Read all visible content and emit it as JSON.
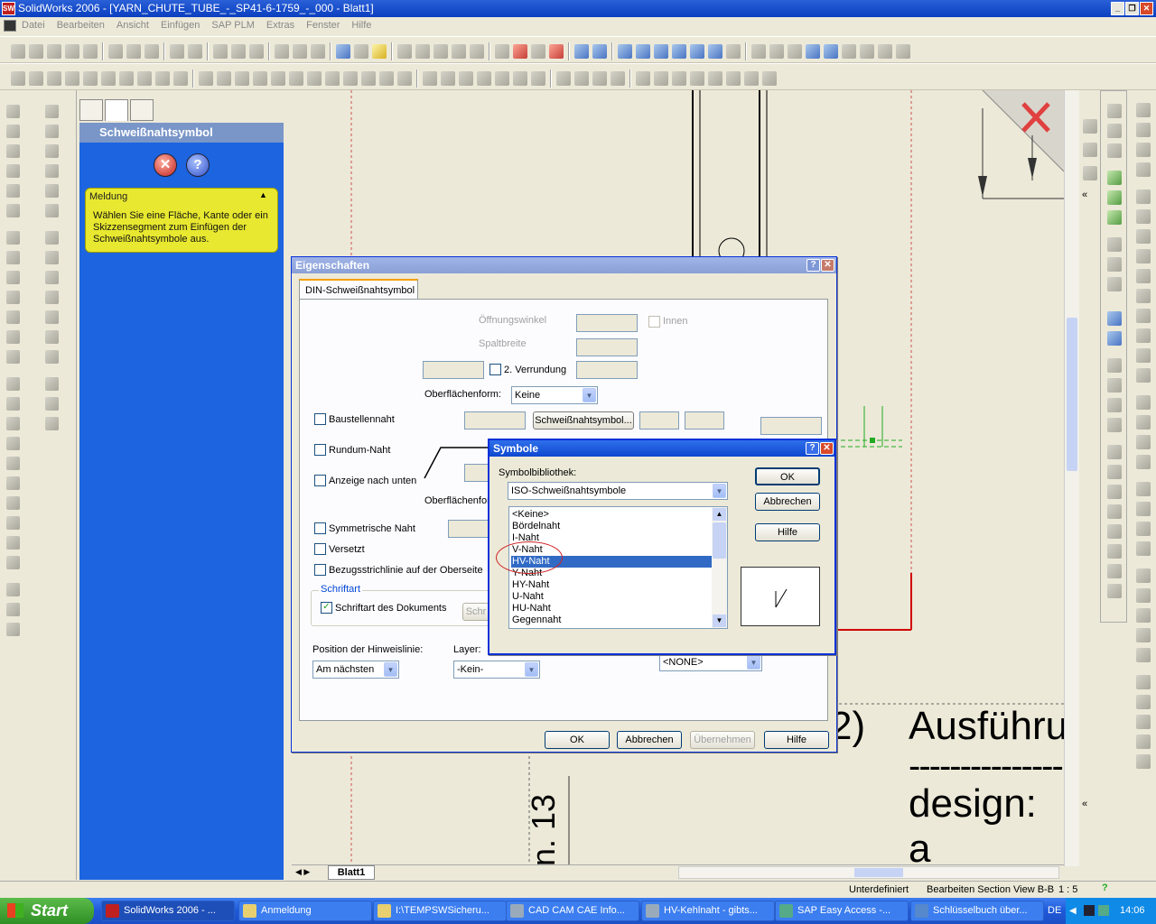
{
  "window": {
    "title": "SolidWorks 2006 - [YARN_CHUTE_TUBE_-_SP41-6-1759_-_000 - Blatt1]"
  },
  "menu": [
    "Datei",
    "Bearbeiten",
    "Ansicht",
    "Einfügen",
    "SAP PLM",
    "Extras",
    "Fenster",
    "Hilfe"
  ],
  "property_manager": {
    "title": "Schweißnahtsymbol",
    "message_title": "Meldung",
    "message_text": "Wählen Sie eine Fläche, Kante oder ein Skizzensegment zum Einfügen der Schweißnahtsymbole aus."
  },
  "eigenschaften": {
    "title": "Eigenschaften",
    "tab": "DIN-Schweißnahtsymbol",
    "oeffnungswinkel": "Öffnungswinkel",
    "innen": "Innen",
    "spaltbreite": "Spaltbreite",
    "verrundung": "2. Verrundung",
    "oberflaechenform": "Oberflächenform:",
    "oberflaechenform_value": "Keine",
    "baustellennaht": "Baustellennaht",
    "schweissnaht_btn": "Schweißnahtsymbol...",
    "rundum": "Rundum-Naht",
    "anzeige": "Anzeige nach unten",
    "oberflaechenform2": "Oberflächenfor",
    "symmetrische": "Symmetrische Naht",
    "versetzt": "Versetzt",
    "bezugs": "Bezugsstrichlinie auf der Oberseite",
    "schriftart_group": "Schriftart",
    "schriftart_doc": "Schriftart des Dokuments",
    "schri_btn": "Schr",
    "position_label": "Position der Hinweislinie:",
    "position_value": "Am nächsten",
    "layer_label": "Layer:",
    "layer_value": "-Kein-",
    "none_value": "<NONE>",
    "ok": "OK",
    "abbrechen": "Abbrechen",
    "uebernehmen": "Übernehmen",
    "hilfe": "Hilfe"
  },
  "symbole": {
    "title": "Symbole",
    "library_label": "Symbolbibliothek:",
    "library_value": "ISO-Schweißnahtsymbole",
    "items": [
      "<Keine>",
      "Bördelnaht",
      "I-Naht",
      "V-Naht",
      "HV-Naht",
      "Y-Naht",
      "HY-Naht",
      "U-Naht",
      "HU-Naht",
      "Gegennaht"
    ],
    "selected": "HV-Naht",
    "ok": "OK",
    "abbrechen": "Abbrechen",
    "hilfe": "Hilfe"
  },
  "drawing": {
    "text1": "Ausführu",
    "text2": "---------------",
    "text3": "design: a",
    "text4": "2)",
    "rot": "n. 13",
    "sheet_tab": "Blatt1"
  },
  "statusbar": {
    "state": "Unterdefiniert",
    "edit": "Bearbeiten Section View B-B",
    "scale": "1 : 5"
  },
  "taskbar": {
    "start": "Start",
    "tasks": [
      "SolidWorks 2006 - ...",
      "Anmeldung",
      "I:\\TEMPSWSicheru...",
      "CAD CAM CAE Info...",
      "HV-Kehlnaht - gibts...",
      "SAP Easy Access -...",
      "Schlüsselbuch über..."
    ],
    "lang": "DE",
    "time": "14:06"
  }
}
